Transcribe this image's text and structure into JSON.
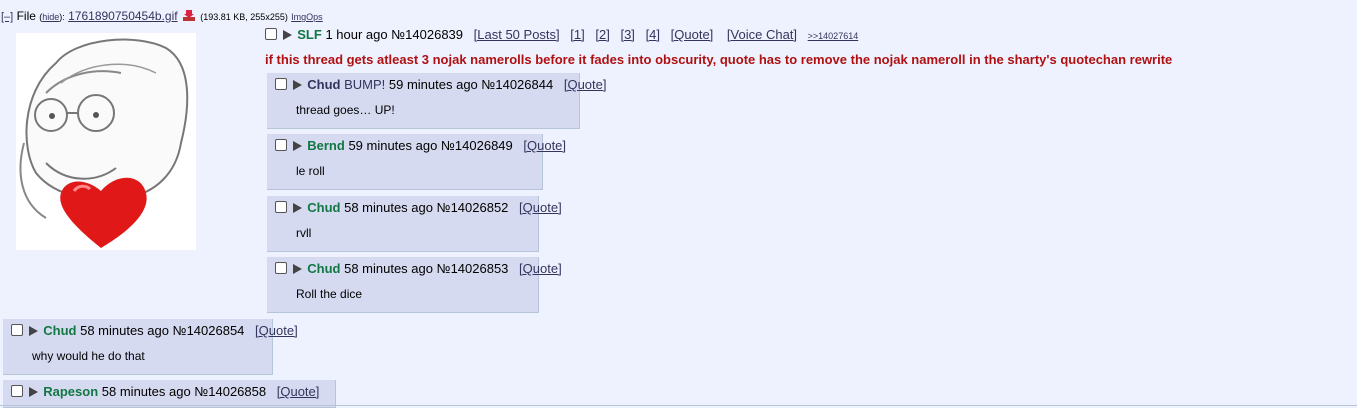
{
  "file": {
    "collapse": "[–]",
    "label": "File",
    "hide_label": "(hide):",
    "hide_text": "hide",
    "filename": "1761890750454b.gif",
    "download_icon": "download-icon",
    "meta": "(193.81 KB, 255x255)",
    "imgops": "ImgOps"
  },
  "op": {
    "name": "SLF",
    "time": "1 hour ago",
    "number": "№14026839",
    "links": [
      "[Last 50 Posts]",
      "[1]",
      "[2]",
      "[3]",
      "[4]",
      "[Quote]",
      "[Voice Chat]"
    ],
    "backlink": ">>14027614",
    "subject": "if this thread gets atleast 3 nojak namerolls before it fades into obscurity, quote has to remove the nojak nameroll in the sharty's quotechan rewrite"
  },
  "replies": [
    {
      "name": "Chud",
      "bump": "BUMP!",
      "time": "59 minutes ago",
      "number": "№14026844",
      "quote": "[Quote]",
      "body": "thread goes… UP!"
    },
    {
      "name": "Bernd",
      "time": "59 minutes ago",
      "number": "№14026849",
      "quote": "[Quote]",
      "body": "le roll"
    },
    {
      "name": "Chud",
      "time": "58 minutes ago",
      "number": "№14026852",
      "quote": "[Quote]",
      "body": "rvll"
    },
    {
      "name": "Chud",
      "time": "58 minutes ago",
      "number": "№14026853",
      "quote": "[Quote]",
      "body": "Roll the dice"
    },
    {
      "name": "Chud",
      "time": "58 minutes ago",
      "number": "№14026854",
      "quote": "[Quote]",
      "body": "why would he do that"
    },
    {
      "name": "Rapeson",
      "time": "58 minutes ago",
      "number": "№14026858",
      "quote": "[Quote]",
      "body": ""
    }
  ],
  "colors": {
    "background": "#eef2ff",
    "reply_bg": "#d6daf0",
    "name": "#117743",
    "subject": "#b01010",
    "link": "#34345c"
  }
}
